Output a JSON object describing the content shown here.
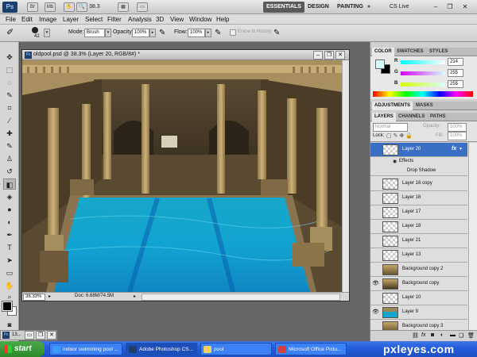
{
  "appbar": {
    "logo": "Ps",
    "zoom": "38.3",
    "workspaces": [
      "ESSENTIALS",
      "DESIGN",
      "PAINTING"
    ],
    "more": "»",
    "cslive": "CS Live"
  },
  "menu": [
    "File",
    "Edit",
    "Image",
    "Layer",
    "Select",
    "Filter",
    "Analysis",
    "3D",
    "View",
    "Window",
    "Help"
  ],
  "options": {
    "brush_size": "42",
    "mode_label": "Mode:",
    "mode_value": "Brush",
    "opacity_label": "Opacity:",
    "opacity_value": "100%",
    "flow_label": "Flow:",
    "flow_value": "100%",
    "erase_history": "Erase to History"
  },
  "document": {
    "title": "oldpool.psd @ 38.3% (Layer 20, RGB/8#) *",
    "zoom": "38.33%",
    "doc_size": "Doc: 6.68M/74.5M"
  },
  "minimized_doc": "13...",
  "color_panel": {
    "tabs": [
      "COLOR",
      "SWATCHES",
      "STYLES"
    ],
    "r_label": "R",
    "r_value": "214",
    "g_label": "G",
    "g_value": "255",
    "b_label": "B",
    "b_value": "255",
    "accent": "#d6ffff"
  },
  "adjust_panel": {
    "tabs": [
      "ADJUSTMENTS",
      "MASKS"
    ]
  },
  "layers_panel": {
    "tabs": [
      "LAYERS",
      "CHANNELS",
      "PATHS"
    ],
    "blend_mode": "Normal",
    "opacity_label": "Opacity:",
    "opacity_value": "100%",
    "lock_label": "Lock:",
    "fill_label": "Fill:",
    "fill_value": "100%",
    "layers": [
      {
        "name": "Layer 20",
        "visible": false,
        "active": true,
        "fx": true
      },
      {
        "name": "Layer 16 copy",
        "visible": false
      },
      {
        "name": "Layer 16",
        "visible": false
      },
      {
        "name": "Layer 17",
        "visible": false
      },
      {
        "name": "Layer 18",
        "visible": false
      },
      {
        "name": "Layer 21",
        "visible": false
      },
      {
        "name": "Layer 13",
        "visible": false
      },
      {
        "name": "Background copy 2",
        "visible": false
      },
      {
        "name": "Background copy",
        "visible": true
      },
      {
        "name": "Layer 10",
        "visible": false
      },
      {
        "name": "Layer 9",
        "visible": true
      },
      {
        "name": "Background copy 3",
        "visible": false
      }
    ],
    "effects_label": "Effects",
    "effect_name": "Drop Shadow"
  },
  "taskbar": {
    "start": "start",
    "tasks": [
      {
        "label": "indoor swimming pool ...",
        "icon": "ie-icon"
      },
      {
        "label": "Adobe Photoshop CS...",
        "icon": "photoshop-icon"
      },
      {
        "label": "pool",
        "icon": "folder-icon"
      },
      {
        "label": "Microsoft Office Pictu...",
        "icon": "picture-manager-icon"
      }
    ]
  },
  "watermark": "pxleyes.com"
}
